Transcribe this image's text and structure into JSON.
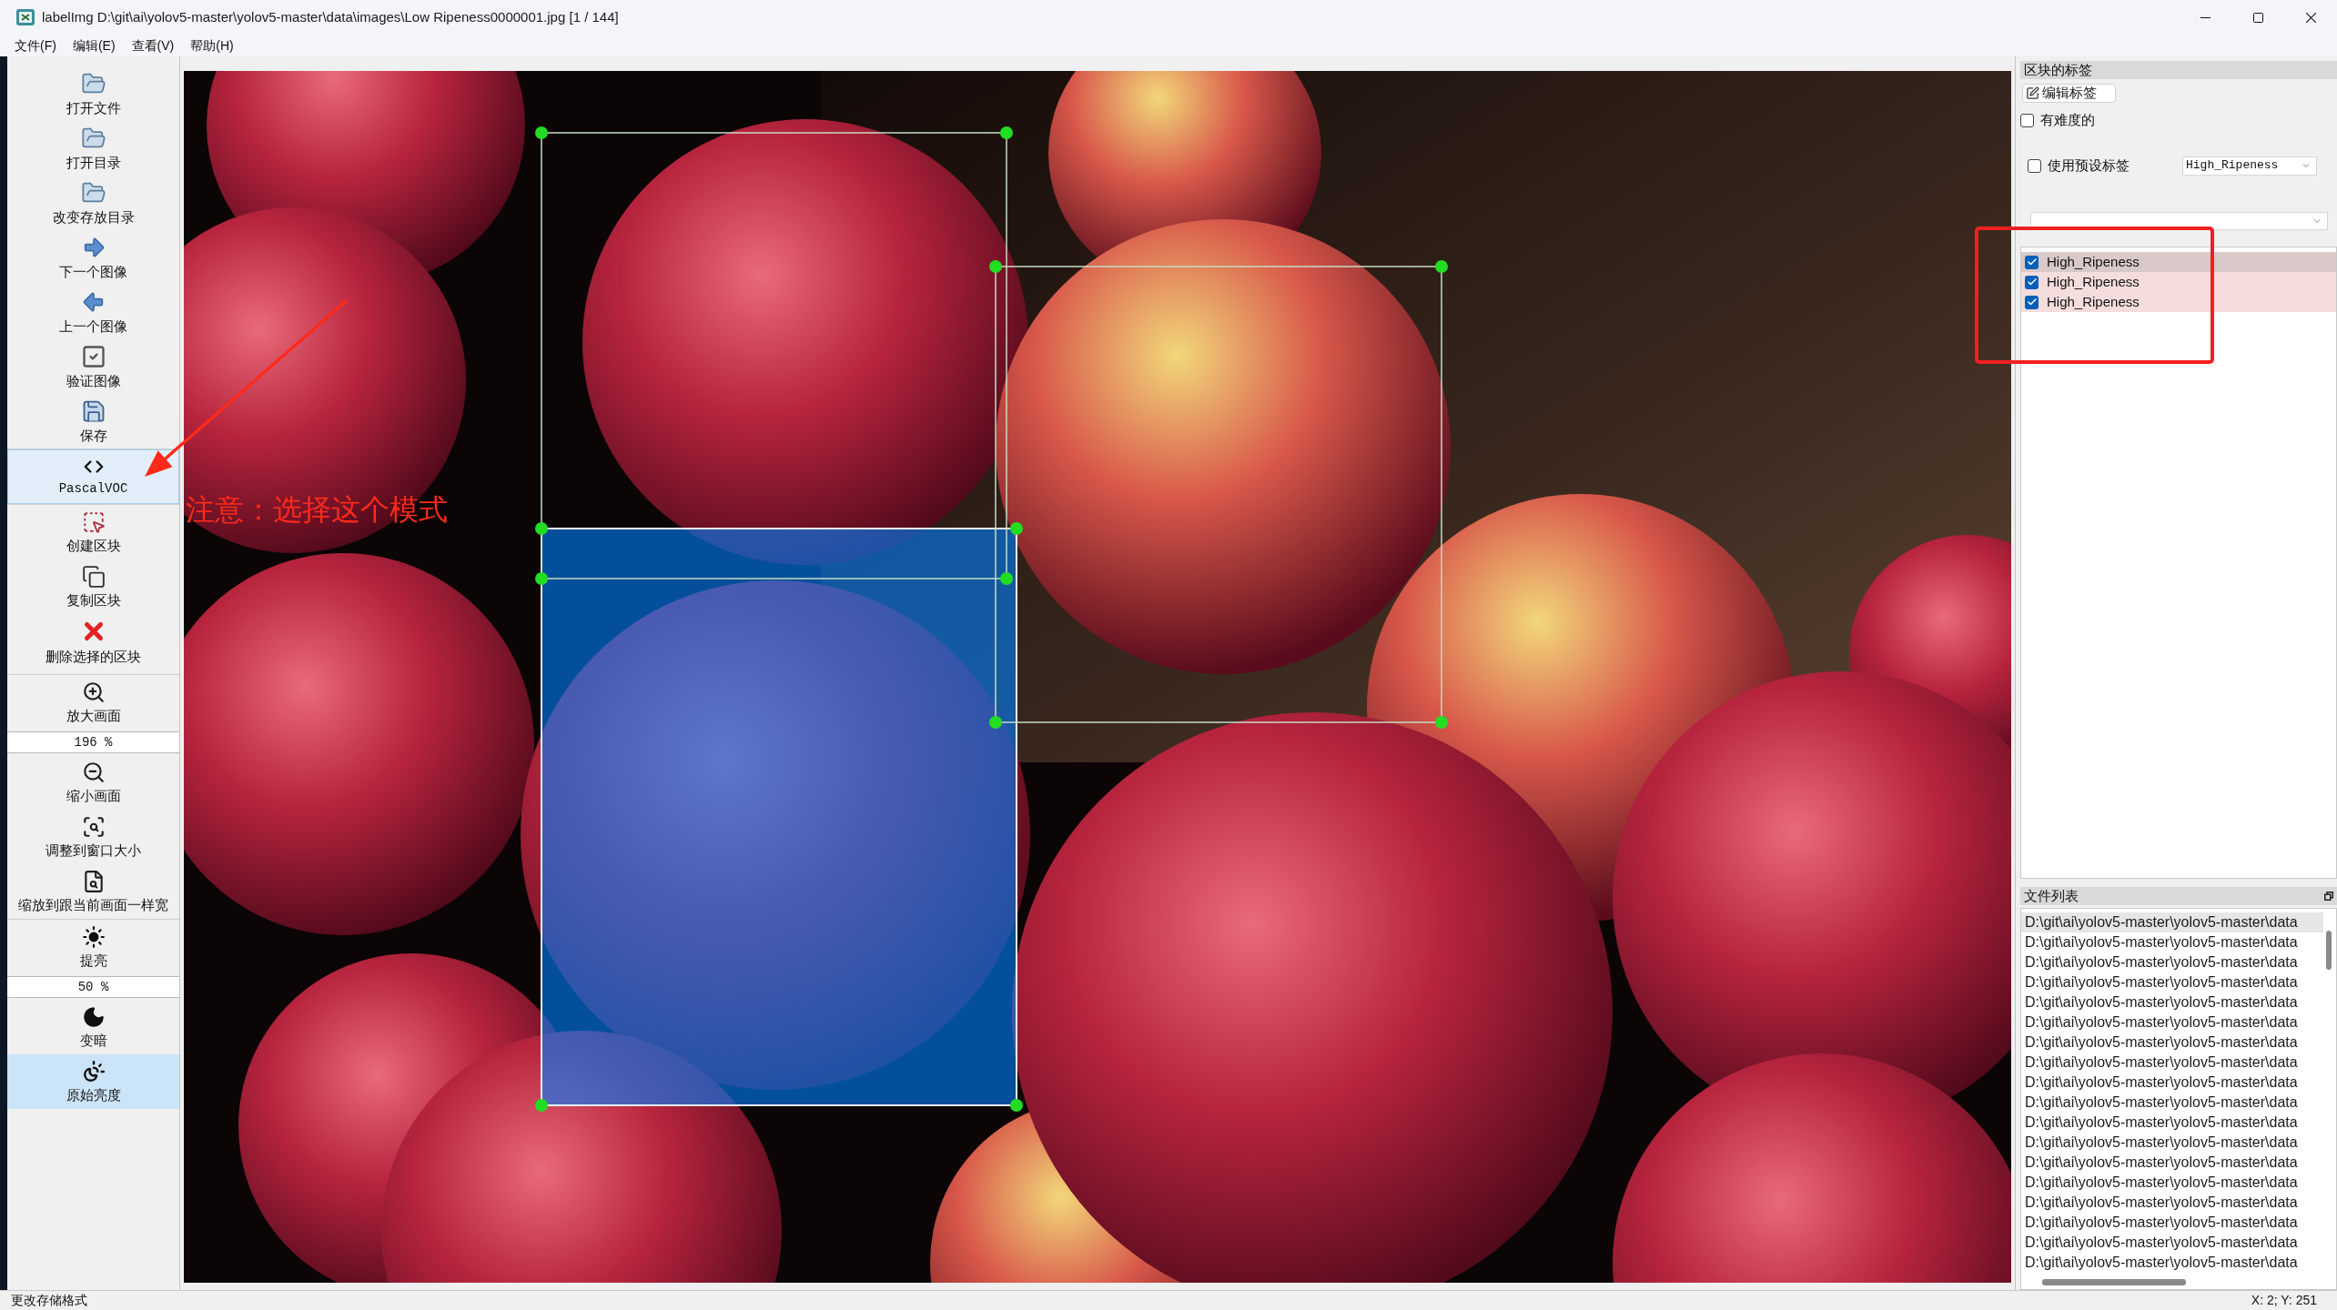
{
  "window": {
    "title": "labelImg D:\\git\\ai\\yolov5-master\\yolov5-master\\data\\images\\Low Ripeness0000001.jpg [1 / 144]"
  },
  "menu": [
    "文件(F)",
    "编辑(E)",
    "查看(V)",
    "帮助(H)"
  ],
  "toolbar": {
    "groups": [
      {
        "items": [
          {
            "kind": "button",
            "label": "打开文件",
            "hovered": false,
            "checked": false
          },
          {
            "kind": "button",
            "label": "打开目录",
            "hovered": false,
            "checked": false
          },
          {
            "kind": "button",
            "label": "改变存放目录",
            "hovered": false,
            "checked": false
          },
          {
            "kind": "button",
            "label": "下一个图像",
            "hovered": false,
            "checked": false
          },
          {
            "kind": "button",
            "label": "上一个图像",
            "hovered": false,
            "checked": false
          },
          {
            "kind": "button",
            "label": "验证图像",
            "hovered": false,
            "checked": false
          },
          {
            "kind": "button",
            "label": "保存",
            "hovered": false,
            "checked": false
          }
        ]
      },
      {
        "items": [
          {
            "kind": "button",
            "label": "PascalVOC",
            "hovered": true,
            "checked": false
          }
        ]
      },
      {
        "items": [
          {
            "kind": "button",
            "label": "创建区块",
            "hovered": false,
            "checked": false
          },
          {
            "kind": "button",
            "label": "复制区块",
            "hovered": false,
            "checked": false
          },
          {
            "kind": "button",
            "label": "删除选择的区块",
            "hovered": false,
            "checked": false
          }
        ]
      },
      {
        "items": [
          {
            "kind": "button",
            "label": "放大画面",
            "hovered": false,
            "checked": false
          },
          {
            "kind": "spinbox",
            "value": "196 %"
          },
          {
            "kind": "button",
            "label": "缩小画面",
            "hovered": false,
            "checked": false
          },
          {
            "kind": "button",
            "label": "调整到窗口大小",
            "hovered": false,
            "checked": false
          },
          {
            "kind": "button",
            "label": "缩放到跟当前画面一样宽",
            "hovered": false,
            "checked": false
          }
        ]
      },
      {
        "items": [
          {
            "kind": "button",
            "label": "提亮",
            "hovered": false,
            "checked": false
          },
          {
            "kind": "spinbox",
            "value": "50 %"
          },
          {
            "kind": "button",
            "label": "变暗",
            "hovered": false,
            "checked": false
          },
          {
            "kind": "button",
            "label": "原始亮度",
            "hovered": false,
            "checked": true
          }
        ]
      }
    ]
  },
  "annotation": {
    "note": "注意：选择这个模式"
  },
  "label_panel": {
    "title": "区块的标签",
    "edit_button": "编辑标签",
    "difficult": {
      "label": "有难度的",
      "checked": false
    },
    "use_default_label": {
      "label": "使用预设标签",
      "checked": false
    },
    "default_label": {
      "value": "High_Ripeness"
    },
    "labels": [
      {
        "text": "High_Ripeness",
        "checked": true,
        "selected": true
      },
      {
        "text": "High_Ripeness",
        "checked": true,
        "selected": false
      },
      {
        "text": "High_Ripeness",
        "checked": true,
        "selected": false
      }
    ]
  },
  "file_panel": {
    "title": "文件列表",
    "files": [
      {
        "path": "D:\\git\\ai\\yolov5-master\\yolov5-master\\data",
        "selected": true
      },
      {
        "path": "D:\\git\\ai\\yolov5-master\\yolov5-master\\data",
        "selected": false
      },
      {
        "path": "D:\\git\\ai\\yolov5-master\\yolov5-master\\data",
        "selected": false
      },
      {
        "path": "D:\\git\\ai\\yolov5-master\\yolov5-master\\data",
        "selected": false
      },
      {
        "path": "D:\\git\\ai\\yolov5-master\\yolov5-master\\data",
        "selected": false
      },
      {
        "path": "D:\\git\\ai\\yolov5-master\\yolov5-master\\data",
        "selected": false
      },
      {
        "path": "D:\\git\\ai\\yolov5-master\\yolov5-master\\data",
        "selected": false
      },
      {
        "path": "D:\\git\\ai\\yolov5-master\\yolov5-master\\data",
        "selected": false
      },
      {
        "path": "D:\\git\\ai\\yolov5-master\\yolov5-master\\data",
        "selected": false
      },
      {
        "path": "D:\\git\\ai\\yolov5-master\\yolov5-master\\data",
        "selected": false
      },
      {
        "path": "D:\\git\\ai\\yolov5-master\\yolov5-master\\data",
        "selected": false
      },
      {
        "path": "D:\\git\\ai\\yolov5-master\\yolov5-master\\data",
        "selected": false
      },
      {
        "path": "D:\\git\\ai\\yolov5-master\\yolov5-master\\data",
        "selected": false
      },
      {
        "path": "D:\\git\\ai\\yolov5-master\\yolov5-master\\data",
        "selected": false
      },
      {
        "path": "D:\\git\\ai\\yolov5-master\\yolov5-master\\data",
        "selected": false
      },
      {
        "path": "D:\\git\\ai\\yolov5-master\\yolov5-master\\data",
        "selected": false
      },
      {
        "path": "D:\\git\\ai\\yolov5-master\\yolov5-master\\data",
        "selected": false
      },
      {
        "path": "D:\\git\\ai\\yolov5-master\\yolov5-master\\data",
        "selected": false
      }
    ]
  },
  "status_bar": {
    "message": "更改存储格式",
    "coordinates": "X: 2; Y: 251"
  }
}
